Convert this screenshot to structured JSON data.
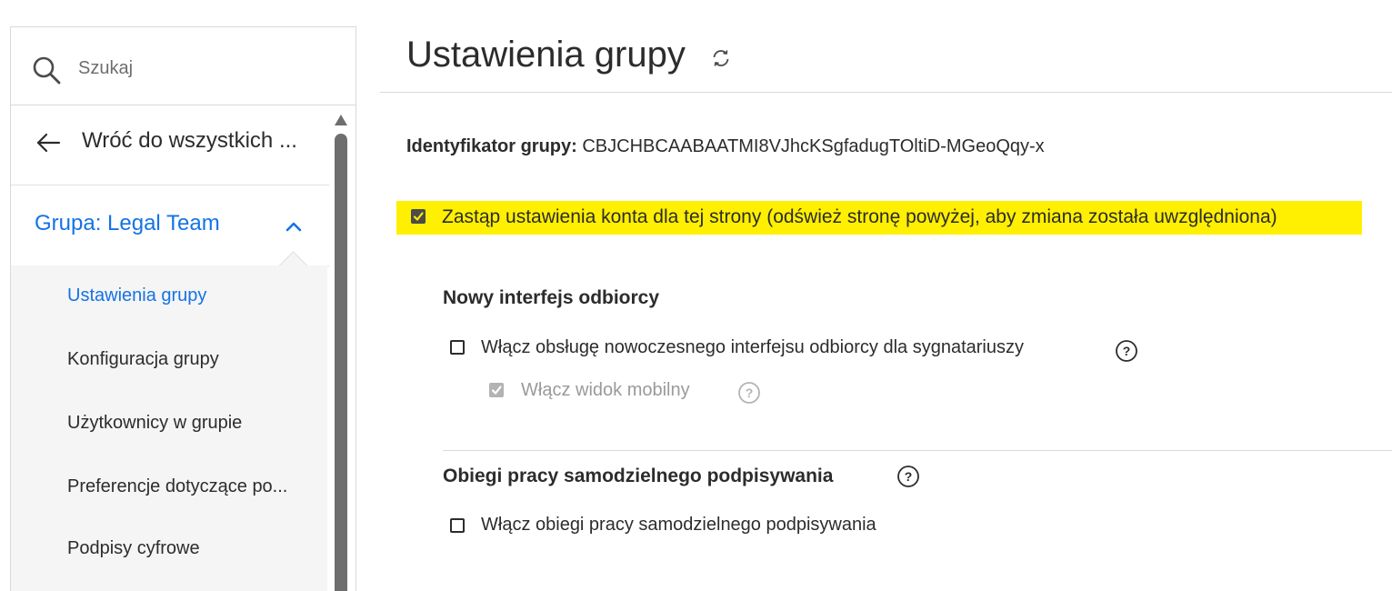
{
  "sidebar": {
    "search": {
      "placeholder": "Szukaj",
      "value": "",
      "icon": "search-icon"
    },
    "back_label": "Wróć do wszystkich ...",
    "group_label": "Grupa: Legal Team",
    "submenu": [
      {
        "label": "Ustawienia grupy",
        "active": true
      },
      {
        "label": "Konfiguracja grupy",
        "active": false
      },
      {
        "label": "Użytkownicy w grupie",
        "active": false
      },
      {
        "label": "Preferencje dotyczące po...",
        "active": false
      },
      {
        "label": "Podpisy cyfrowe",
        "active": false
      }
    ]
  },
  "main": {
    "title": "Ustawienia grupy",
    "group_id_label": "Identyfikator grupy:",
    "group_id_value": "CBJCHBCAABAATMI8VJhcKSgfadugTOltiD-MGeoQqy-x",
    "override": {
      "label": "Zastąp ustawienia konta dla tej strony (odśwież stronę powyżej, aby zmiana została uwzględniona)",
      "checked": true
    },
    "sections": [
      {
        "title": "Nowy interfejs odbiorcy",
        "options": [
          {
            "label": "Włącz obsługę nowoczesnego interfejsu odbiorcy dla sygnatariuszy",
            "checked": false,
            "disabled": false
          },
          {
            "label": "Włącz widok mobilny",
            "checked": true,
            "disabled": true
          }
        ]
      },
      {
        "title": "Obiegi pracy samodzielnego podpisywania",
        "options": [
          {
            "label": "Włącz obiegi pracy samodzielnego podpisywania",
            "checked": false,
            "disabled": false
          }
        ]
      }
    ]
  },
  "colors": {
    "accent": "#1473e6",
    "highlight": "#ffef00",
    "text": "#2c2c2c",
    "muted": "#9a9a9a"
  }
}
